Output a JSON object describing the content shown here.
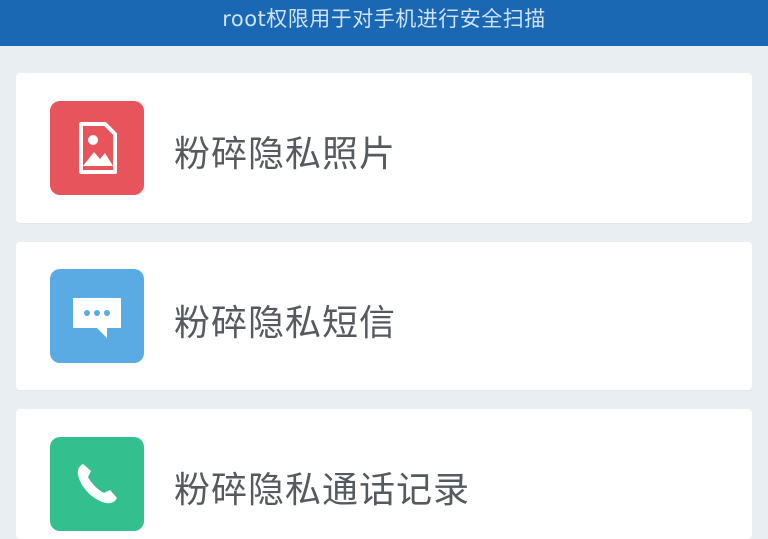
{
  "header": {
    "subtitle": "root权限用于对手机进行安全扫描",
    "background": "#1a67b3"
  },
  "items": [
    {
      "label": "粉碎隐私照片",
      "icon": "photo-icon",
      "color": "#e8545b"
    },
    {
      "label": "粉碎隐私短信",
      "icon": "message-icon",
      "color": "#5aabe3"
    },
    {
      "label": "粉碎隐私通话记录",
      "icon": "phone-icon",
      "color": "#33bf8e"
    }
  ]
}
